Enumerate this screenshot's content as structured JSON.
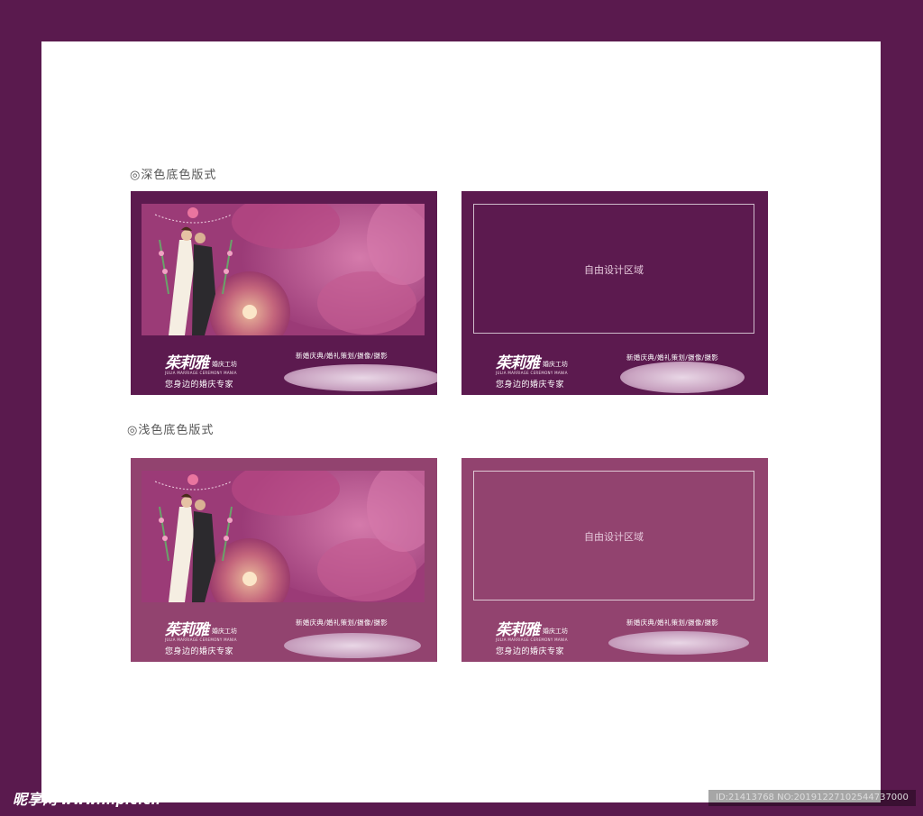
{
  "sections": [
    {
      "label": "◎深色底色版式"
    },
    {
      "label": "◎浅色底色版式"
    }
  ],
  "card": {
    "logo_name": "茱莉雅",
    "logo_suffix": "婚庆工坊",
    "logo_en": "JULIA MARRIAGE CEREMONY MANIA",
    "slogan": "您身边的婚庆专家",
    "services": "新婚庆典/婚礼策划/摄像/摄影",
    "design_area": "自由设计区域"
  },
  "colors": {
    "outer_bg": "#5a1a4e",
    "dark_card": "#5c1a4f",
    "light_card": "#92436f"
  },
  "watermark": {
    "site": "昵享网",
    "url": "www.nipic.cn",
    "id_text": "ID:21413768 NO:20191227102544737000"
  }
}
